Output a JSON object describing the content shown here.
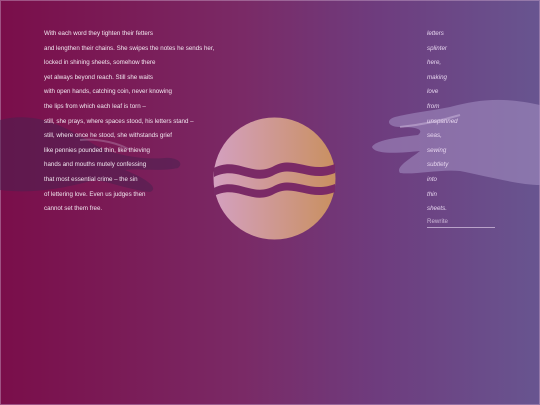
{
  "poem": {
    "lines": [
      "With each word they tighten their fetters",
      "and lengthen their chains. She swipes the notes he sends her,",
      "locked in shining sheets, somehow there",
      "yet always beyond reach. Still she waits",
      "with open hands, catching coin, never knowing",
      "the lips from which each leaf is torn –",
      "still, she prays, where spaces stood, his letters stand –",
      "still, where once he stood, she withstands grief",
      "like pennies pounded thin, like thieving",
      "hands and mouths mutely confessing",
      "that most essential crime – the sin",
      "of lettering love. Even us judges then",
      "cannot set them free."
    ]
  },
  "word_column": {
    "words": [
      "letters",
      "splinter",
      "here,",
      "making",
      "love",
      "from",
      "unspanned",
      "seas,",
      "sewing",
      "subtlety",
      "into",
      "thin",
      "sheets."
    ]
  },
  "rewrite": {
    "label": "Rewrite"
  },
  "icons": {
    "emblem": "sun-over-waves-emblem",
    "left": "reaching-hand-left",
    "right": "reaching-hand-right"
  },
  "colors": {
    "background_left": "#7a0e4a",
    "background_right": "#685590",
    "emblem_light": "#d4a0c0",
    "emblem_warm": "#c99060"
  }
}
